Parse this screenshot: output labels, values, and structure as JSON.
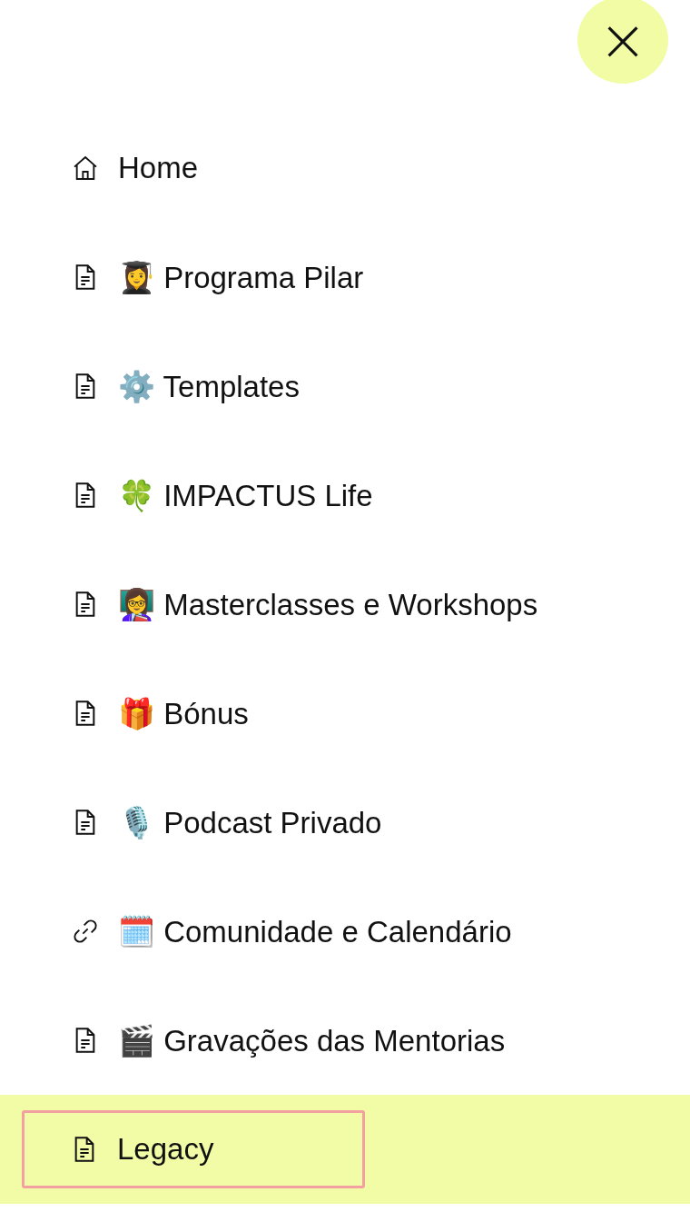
{
  "close_button": {
    "label": "×"
  },
  "menu": [
    {
      "kind": "home",
      "label": "Home",
      "selected": false
    },
    {
      "kind": "page",
      "label": "👩‍🎓 Programa Pilar",
      "selected": false
    },
    {
      "kind": "page",
      "label": "⚙️ Templates",
      "selected": false
    },
    {
      "kind": "page",
      "label": "🍀 IMPACTUS Life",
      "selected": false
    },
    {
      "kind": "page",
      "label": "👩‍🏫 Masterclasses e Workshops",
      "selected": false
    },
    {
      "kind": "page",
      "label": "🎁 Bónus",
      "selected": false
    },
    {
      "kind": "page",
      "label": "🎙️ Podcast Privado",
      "selected": false
    },
    {
      "kind": "link",
      "label": "🗓️ Comunidade e Calendário",
      "selected": false
    },
    {
      "kind": "page",
      "label": "🎬 Gravações das Mentorias",
      "selected": false
    },
    {
      "kind": "page",
      "label": "Legacy",
      "selected": true
    }
  ]
}
